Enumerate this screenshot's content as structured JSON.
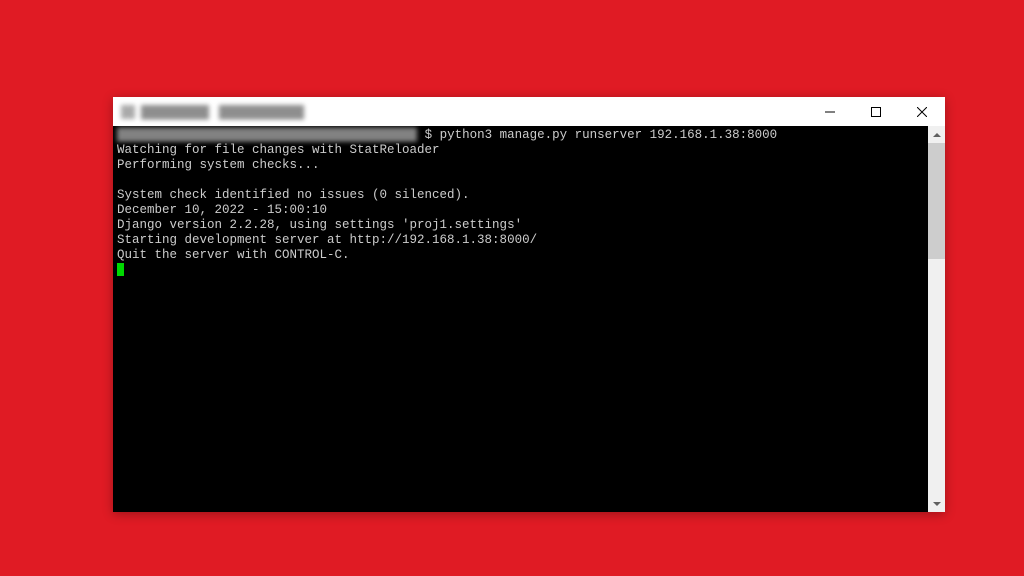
{
  "window": {
    "title": "████████   ██████████"
  },
  "terminal": {
    "prompt_hidden": "████████████████████████████████████████",
    "command": "$ python3 manage.py runserver 192.168.1.38:8000",
    "lines": {
      "l1": "Watching for file changes with StatReloader",
      "l2": "Performing system checks...",
      "l3": "",
      "l4": "System check identified no issues (0 silenced).",
      "l5": "December 10, 2022 - 15:00:10",
      "l6": "Django version 2.2.28, using settings 'proj1.settings'",
      "l7": "Starting development server at http://192.168.1.38:8000/",
      "l8": "Quit the server with CONTROL-C."
    }
  }
}
